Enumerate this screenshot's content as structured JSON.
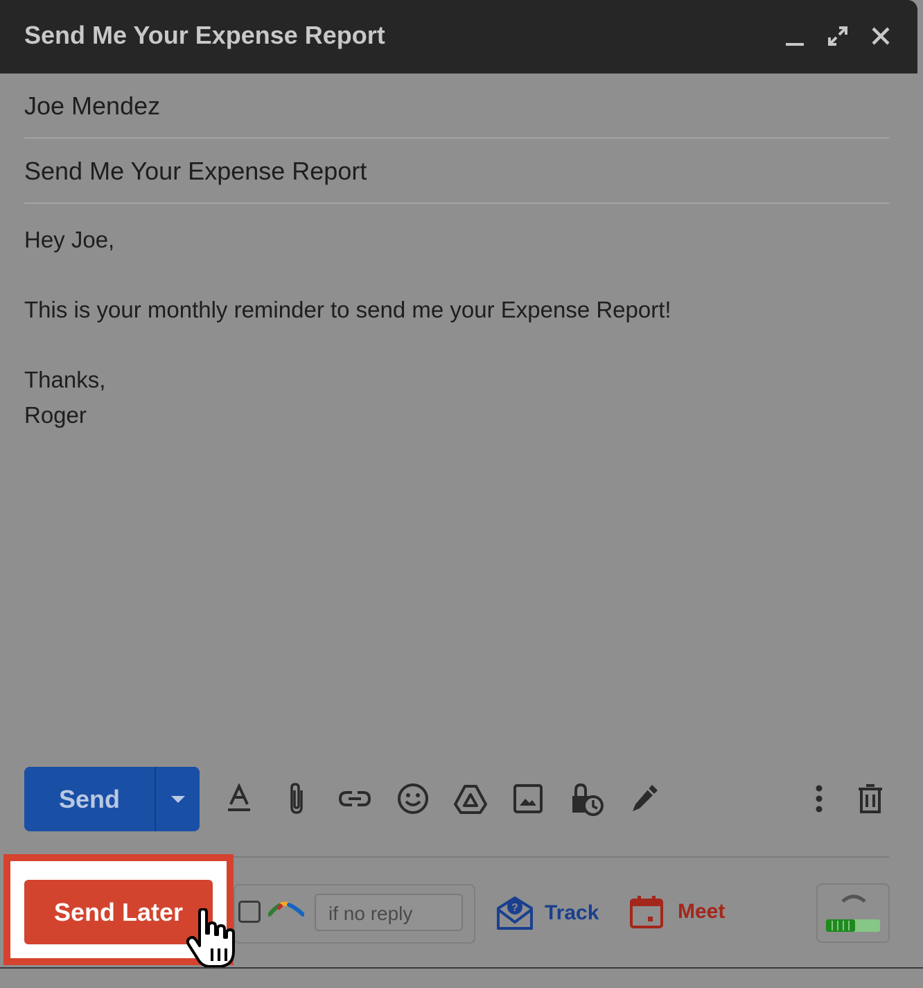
{
  "window": {
    "title": "Send Me Your Expense Report",
    "controls": [
      "minimize-icon",
      "expand-icon",
      "close-icon"
    ]
  },
  "compose": {
    "to": "Joe Mendez",
    "subject": "Send Me Your Expense Report",
    "body": {
      "greeting": "Hey Joe,",
      "message": "This is your monthly reminder to send me your Expense Report!",
      "signoff": "Thanks,",
      "signature": "Roger"
    }
  },
  "toolbar": {
    "send_label": "Send",
    "tools": [
      "text-format-icon",
      "attach-icon",
      "link-icon",
      "emoji-icon",
      "drive-icon",
      "image-icon",
      "confidential-mode-icon",
      "signature-icon",
      "more-options-icon",
      "delete-icon"
    ]
  },
  "boomerang": {
    "send_later_label": "Send Later",
    "no_reply_placeholder": "if no reply",
    "track_label": "Track",
    "meet_label": "Meet"
  },
  "colors": {
    "highlight": "#d5432f",
    "send": "#1a4fa6",
    "send_later": "#d3442e"
  }
}
